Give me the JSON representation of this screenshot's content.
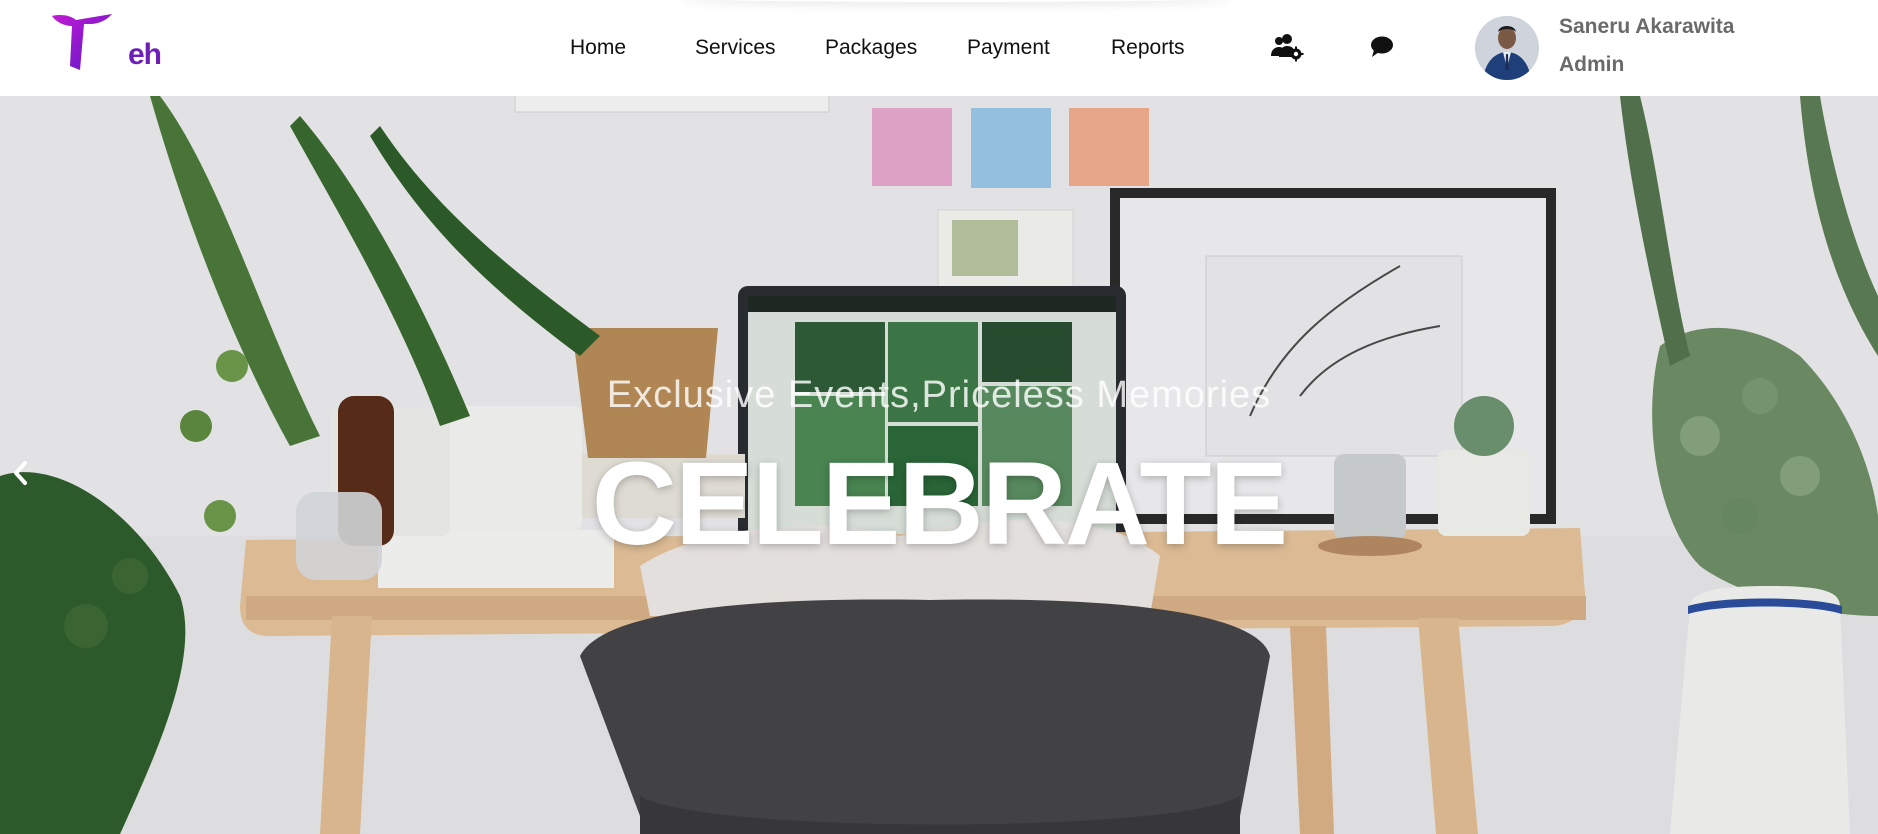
{
  "brand": {
    "logo_text": "Teh",
    "logo_sub": "eh",
    "colors": {
      "primary": "#7a1fd0",
      "secondary": "#b51ed0"
    }
  },
  "nav": {
    "items": [
      {
        "label": "Home"
      },
      {
        "label": "Services"
      },
      {
        "label": "Packages"
      },
      {
        "label": "Payment"
      },
      {
        "label": "Reports"
      }
    ]
  },
  "header_icons": {
    "team": "users-gear-icon",
    "chat": "chat-bubble-icon"
  },
  "user": {
    "name": "Saneru Akarawita",
    "role": "Admin"
  },
  "hero": {
    "tagline": "Exclusive Events,Priceless Memories",
    "title": "CELEBRATE",
    "prev_icon": "chevron-left-icon"
  }
}
